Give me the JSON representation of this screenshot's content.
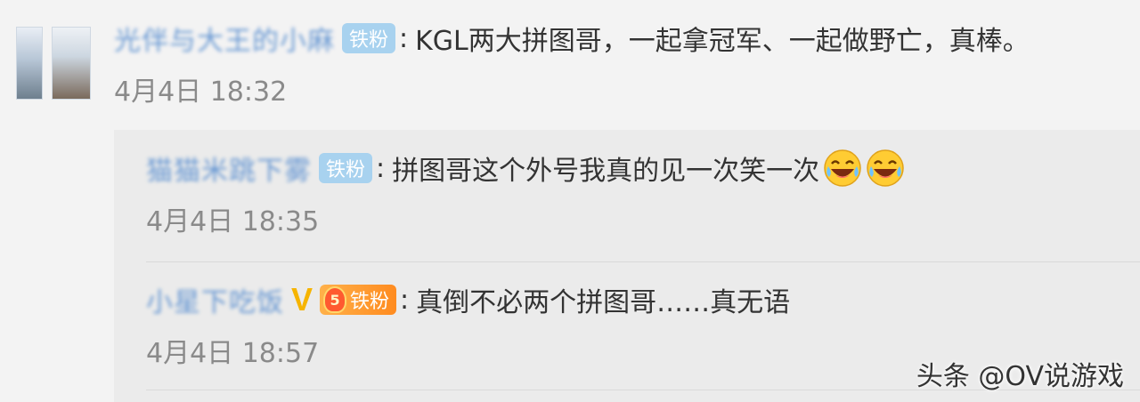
{
  "top_comment": {
    "username": "光伴与大王的小麻",
    "badge": "铁粉",
    "colon": ":",
    "text": "KGL两大拼图哥，一起拿冠军、一起做野亡，真棒。",
    "time": "4月4日  18:32"
  },
  "replies": [
    {
      "username": "猫猫米跳下雾",
      "badge": "铁粉",
      "colon": ":",
      "text": "拼图哥这个外号我真的见一次笑一次",
      "emoji": [
        "laugh-cry-emoji",
        "laugh-cry-emoji"
      ],
      "time": "4月4日  18:35"
    },
    {
      "username": "小星下吃饭",
      "verified": "V",
      "level": "5",
      "badge": "铁粉",
      "colon": ":",
      "text": "真倒不必两个拼图哥……真无语",
      "time": "4月4日  18:57"
    }
  ],
  "watermark": "头条 @OV说游戏",
  "colors": {
    "username": "#5a8fd0",
    "badge": "#a8d2ef",
    "badge_gold": "#ff8b1f",
    "text": "#333333",
    "time": "#8a8a8a"
  }
}
